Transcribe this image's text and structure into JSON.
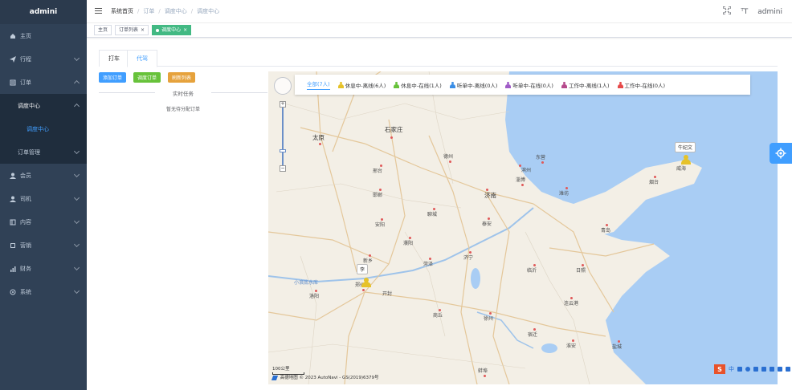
{
  "app": {
    "title": "admini"
  },
  "sidebar": {
    "items": [
      {
        "label": "主页",
        "icon": "home-icon"
      },
      {
        "label": "行程",
        "icon": "send-icon"
      },
      {
        "label": "订单",
        "icon": "order-icon"
      },
      {
        "label": "调度中心",
        "icon": ""
      },
      {
        "label": "调度中心",
        "icon": ""
      },
      {
        "label": "订单管理",
        "icon": ""
      },
      {
        "label": "会员",
        "icon": "user-icon"
      },
      {
        "label": "司机",
        "icon": "driver-icon"
      },
      {
        "label": "内容",
        "icon": "content-icon"
      },
      {
        "label": "营销",
        "icon": "marketing-icon"
      },
      {
        "label": "财务",
        "icon": "finance-icon"
      },
      {
        "label": "系统",
        "icon": "system-icon"
      }
    ]
  },
  "header": {
    "breadcrumb": [
      "系统首页",
      "订单",
      "调度中心",
      "调度中心"
    ],
    "user": "admini",
    "font_size_icon": "ᵀT"
  },
  "tags": {
    "items": [
      "主页",
      "订单列表",
      "调度中心"
    ]
  },
  "main": {
    "tabs": [
      "打车",
      "代驾"
    ],
    "buttons": {
      "add": "添加订单",
      "dispatch": "调度订单",
      "refresh": "刷新列表"
    },
    "realtime_title": "实时任务",
    "empty_text": "暂无待分配订单"
  },
  "map": {
    "legend": [
      {
        "label": "全部(7人)",
        "color": "#409eff"
      },
      {
        "label": "休息中-离线(6人)",
        "color": "#e6c229"
      },
      {
        "label": "休息中-在线(1人)",
        "color": "#67c23a"
      },
      {
        "label": "听单中-离线(0人)",
        "color": "#3a8ee6"
      },
      {
        "label": "听单中-在线(0人)",
        "color": "#a05cc7"
      },
      {
        "label": "工作中-离线(1人)",
        "color": "#b54a8c"
      },
      {
        "label": "工作中-在线(0人)",
        "color": "#e64a4a"
      }
    ],
    "markers": [
      {
        "label": "牛纪文"
      },
      {
        "label": "李"
      }
    ],
    "cities": {
      "shijiazhuang": "石家庄",
      "taiyuan": "太原",
      "jinan": "济南",
      "weihai": "威海",
      "zhengzhou": "郑州",
      "kaifeng": "开封",
      "xingtai": "邢台",
      "handan": "邯郸",
      "dezhou": "德州",
      "binzhou": "滨州",
      "weifang": "潍坊",
      "qingdao": "青岛",
      "linyi": "临沂",
      "xuzhou": "徐州",
      "shangqiu": "商丘",
      "heze": "菏泽",
      "jining": "济宁",
      "zibo": "淄博",
      "dongying": "东营",
      "yantai": "烟台",
      "luoyang": "洛阳",
      "xinxiang": "新乡",
      "anyang": "安阳",
      "puyang": "濮阳",
      "liaocheng": "聊城",
      "taian": "泰安",
      "rizhao": "日照",
      "lianyungang": "连云港",
      "suqian": "宿迁",
      "huaian": "淮安",
      "yancheng": "盐城",
      "bengbu": "蚌埠",
      "xiaolangdi": "小浪底水库"
    },
    "scale": "100公里",
    "copyright": "高德地图 © 2023 AutoNavi - GS(2019)6379号"
  },
  "ime": {
    "brand": "S",
    "lang": "中"
  }
}
